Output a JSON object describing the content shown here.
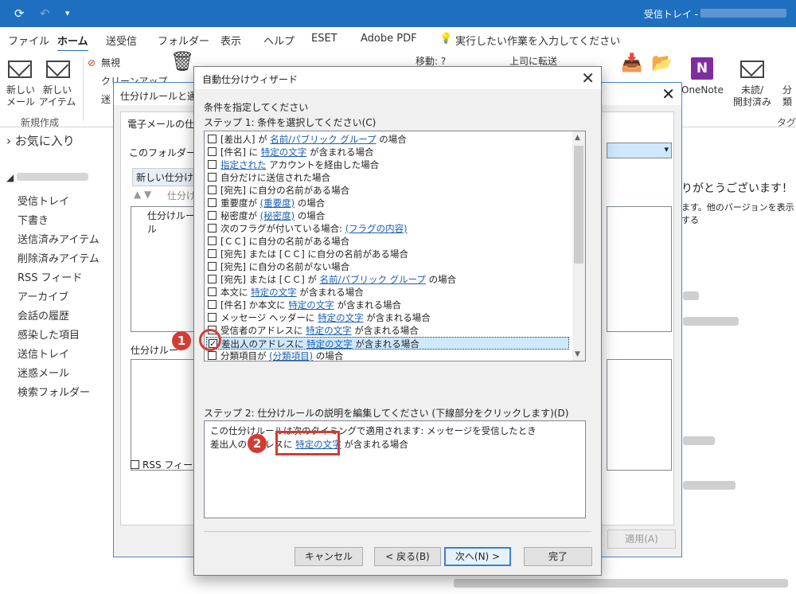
{
  "titlebar": {
    "title": "受信トレイ - "
  },
  "tabs": [
    "ファイル",
    "ホーム",
    "送受信",
    "フォルダー",
    "表示",
    "ヘルプ",
    "ESET",
    "Adobe PDF",
    "実行したい作業を入力してください"
  ],
  "ribbon": {
    "new_mail": "新しい\nメール",
    "new_items": "新しい\nアイテム",
    "group_new": "新規作成",
    "ignore": "無視",
    "cleanup": "クリーンアップ",
    "junk": "迷",
    "move_to": "移動: ?",
    "forward_to": "上司に転送",
    "onenote": "OneNote",
    "unread_read": "未読/\n開封済み",
    "categorize": "分類",
    "group_tags": "タグ"
  },
  "nav": {
    "favorites": "お気に入り",
    "items": [
      "受信トレイ",
      "下書き",
      "送信済みアイテム",
      "削除済みアイテム",
      "RSS フィード",
      "アーカイブ",
      "会話の履歴",
      "感染した項目",
      "送信トレイ",
      "迷惑メール",
      "検索フォルダー"
    ]
  },
  "background": {
    "thanks": "りがとうございます！",
    "version_note": "ます。他のバージョンを表示する"
  },
  "rules_dialog": {
    "title": "仕分けルールと通知",
    "tab": "電子メールの仕分",
    "folder_label": "このフォルダーに変",
    "new_rule_button": "新しい仕分け",
    "change_label": "仕分け",
    "col_rule": "仕分けルール",
    "desc_label": "仕分けルー",
    "rss_checkbox": "RSS フィードが",
    "apply_button": "適用(A)"
  },
  "wizard": {
    "title": "自動仕分けウィザード",
    "heading": "条件を指定してください",
    "step1": "ステップ 1: 条件を選択してください(C)",
    "conditions": [
      {
        "pre": "[差出人] が ",
        "link": "名前/パブリック グループ",
        "post": " の場合",
        "checked": false
      },
      {
        "pre": "[件名] に ",
        "link": "特定の文字",
        "post": " が含まれる場合",
        "checked": false
      },
      {
        "pre": "",
        "link": "指定された",
        "post": " アカウントを経由した場合",
        "checked": false
      },
      {
        "pre": "自分だけに送信された場合",
        "link": "",
        "post": "",
        "checked": false
      },
      {
        "pre": "[宛先] に自分の名前がある場合",
        "link": "",
        "post": "",
        "checked": false
      },
      {
        "pre": "重要度が ",
        "link": "(重要度)",
        "post": " の場合",
        "checked": false
      },
      {
        "pre": "秘密度が ",
        "link": "(秘密度)",
        "post": " の場合",
        "checked": false
      },
      {
        "pre": "次のフラグが付いている場合: ",
        "link": "(フラグの内容)",
        "post": "",
        "checked": false
      },
      {
        "pre": "[ＣＣ] に自分の名前がある場合",
        "link": "",
        "post": "",
        "checked": false
      },
      {
        "pre": "[宛先] または [ＣＣ] に自分の名前がある場合",
        "link": "",
        "post": "",
        "checked": false
      },
      {
        "pre": "[宛先] に自分の名前がない場合",
        "link": "",
        "post": "",
        "checked": false
      },
      {
        "pre": "[宛先] または [ＣＣ] が ",
        "link": "名前/パブリック グループ",
        "post": " の場合",
        "checked": false
      },
      {
        "pre": "本文に ",
        "link": "特定の文字",
        "post": " が含まれる場合",
        "checked": false
      },
      {
        "pre": "[件名] か本文に ",
        "link": "特定の文字",
        "post": " が含まれる場合",
        "checked": false
      },
      {
        "pre": "メッセージ ヘッダーに ",
        "link": "特定の文字",
        "post": " が含まれる場合",
        "checked": false
      },
      {
        "pre": "受信者のアドレスに ",
        "link": "特定の文字",
        "post": " が含まれる場合",
        "checked": false
      },
      {
        "pre": "差出人のアドレスに ",
        "link": "特定の文字",
        "post": " が含まれる場合",
        "checked": true
      },
      {
        "pre": "分類項目が ",
        "link": "(分類項目)",
        "post": " の場合",
        "checked": false
      }
    ],
    "step2": "ステップ 2: 仕分けルールの説明を編集してください (下線部分をクリックします)(D)",
    "desc_line1": "この仕分けルールは次のタイミングで適用されます: メッセージを受信したとき",
    "desc_line2_pre": "差出人のアドレスに ",
    "desc_line2_link": "特定の文字",
    "desc_line2_post": " が含まれる場合",
    "buttons": {
      "cancel": "キャンセル",
      "back": "< 戻る(B)",
      "next": "次へ(N) >",
      "finish": "完了"
    }
  },
  "annotations": {
    "badge1": "1",
    "badge2": "2"
  },
  "colors": {
    "accent": "#1e6fc0",
    "annotation": "#d43c33",
    "link": "#1a5fb4"
  }
}
